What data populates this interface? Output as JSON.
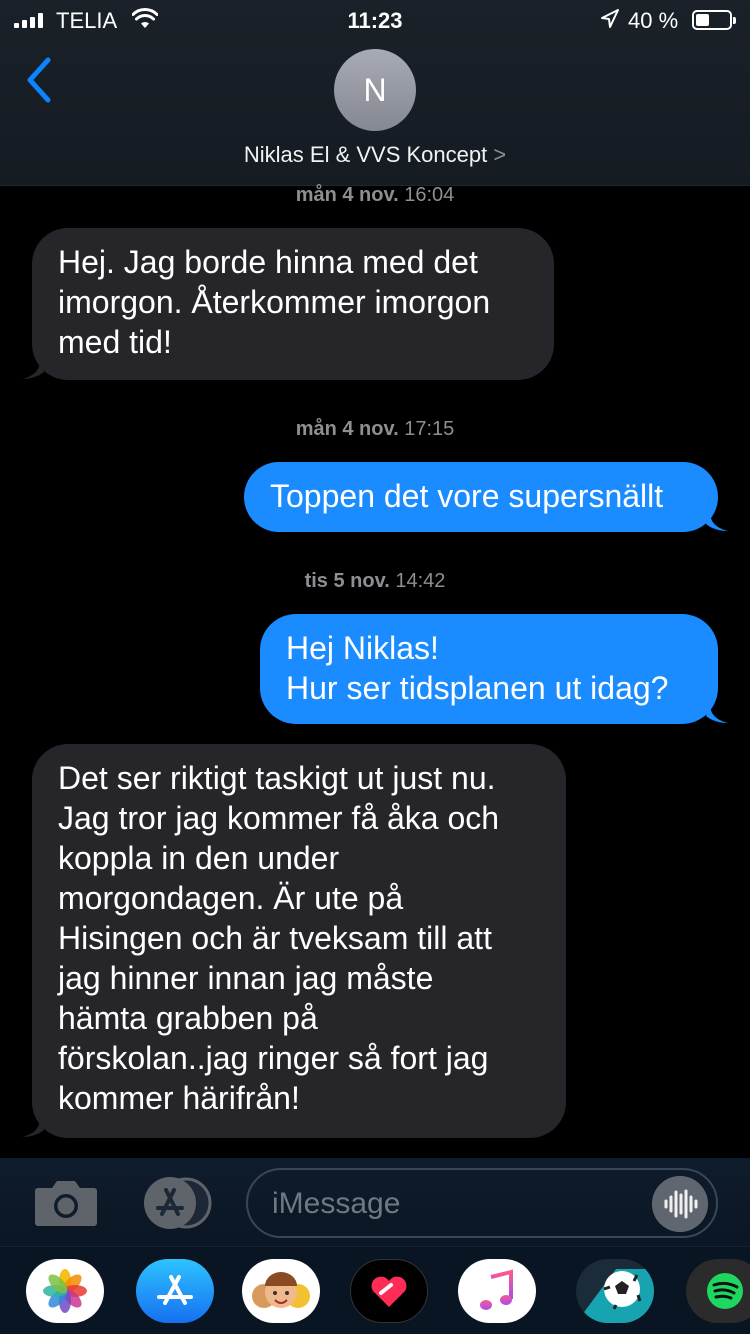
{
  "status_bar": {
    "carrier": "TELIA",
    "time": "11:23",
    "battery_percent": "40 %",
    "battery_level": 0.4
  },
  "header": {
    "avatar_initial": "N",
    "contact_name": "Niklas El & VVS Koncept",
    "chevron": ">"
  },
  "messages": [
    {
      "type": "timestamp",
      "day": "mån 4 nov.",
      "time": "16:04"
    },
    {
      "type": "incoming",
      "text": "Hej. Jag borde hinna med det\nimorgon. Återkommer imorgon\nmed tid!"
    },
    {
      "type": "timestamp",
      "day": "mån 4 nov.",
      "time": "17:15"
    },
    {
      "type": "outgoing",
      "text": "Toppen det vore supersnällt"
    },
    {
      "type": "timestamp",
      "day": "tis 5 nov.",
      "time": "14:42"
    },
    {
      "type": "outgoing",
      "text": "Hej Niklas!\nHur ser tidsplanen ut idag?"
    },
    {
      "type": "incoming",
      "text": "Det ser riktigt taskigt ut just nu.\nJag tror jag kommer få åka och\nkoppla in den under\nmorgondagen. Är ute på\nHisingen och är tveksam till att\njag hinner innan jag måste\nhämta grabben på\nförskolan..jag ringer så fort jag\nkommer härifrån!"
    }
  ],
  "input": {
    "placeholder": "iMessage"
  },
  "app_drawer": [
    "photos-icon",
    "app-store-icon",
    "memoji-icon",
    "digital-touch-icon",
    "music-icon",
    "soccer-app-icon",
    "spotify-icon"
  ],
  "colors": {
    "outgoing_bubble": "#1a8cff",
    "incoming_bubble": "#26252a",
    "accent": "#0a84ff"
  }
}
